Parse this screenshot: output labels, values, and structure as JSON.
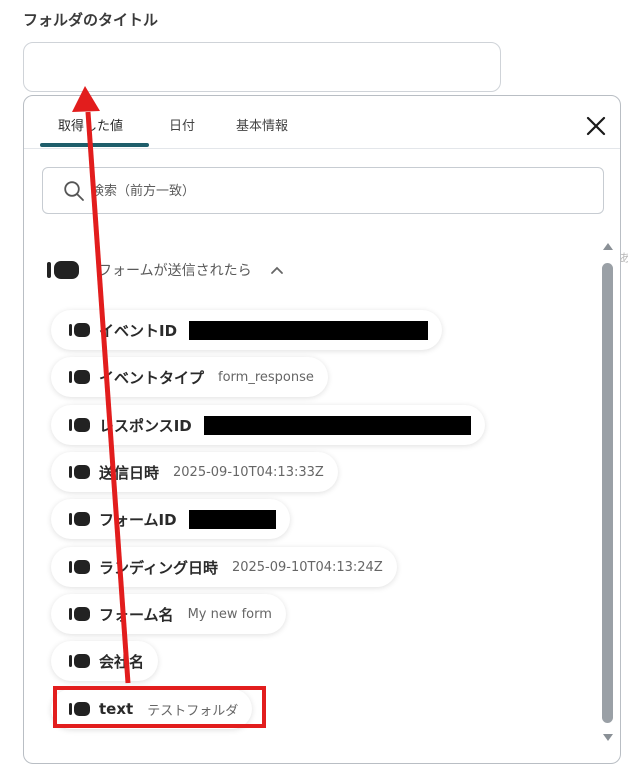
{
  "folder_field": {
    "label": "フォルダのタイトル",
    "value": ""
  },
  "picker": {
    "tabs": [
      {
        "label": "取得した値",
        "active": true
      },
      {
        "label": "日付",
        "active": false
      },
      {
        "label": "基本情報",
        "active": false
      }
    ],
    "search": {
      "placeholder": "検索（前方一致）",
      "value": ""
    },
    "group": {
      "title": "フォームが送信されたら",
      "expanded": true
    },
    "items": [
      {
        "key": "イベントID",
        "value": "",
        "redacted": true
      },
      {
        "key": "イベントタイプ",
        "value": "form_response",
        "redacted": false
      },
      {
        "key": "レスポンスID",
        "value": "",
        "redacted": true
      },
      {
        "key": "送信日時",
        "value": "2025-09-10T04:13:33Z",
        "redacted": false
      },
      {
        "key": "フォームID",
        "value": "",
        "redacted": true
      },
      {
        "key": "ランディング日時",
        "value": "2025-09-10T04:13:24Z",
        "redacted": false
      },
      {
        "key": "フォーム名",
        "value": "My new form",
        "redacted": false
      },
      {
        "key": "会社名",
        "value": "",
        "redacted": false
      },
      {
        "key": "text",
        "value": "テストフォルダ",
        "redacted": false,
        "highlighted": true
      }
    ],
    "edge_text": "あ"
  },
  "colors": {
    "tab_active_underline": "#1f5e6b",
    "highlight_red": "#e21d1d",
    "scroll_thumb": "#9aa0a6"
  },
  "icons": [
    "close-icon",
    "search-icon",
    "tag-icon",
    "chevron-up-icon",
    "scroll-up-arrow-icon",
    "scroll-down-arrow-icon"
  ]
}
